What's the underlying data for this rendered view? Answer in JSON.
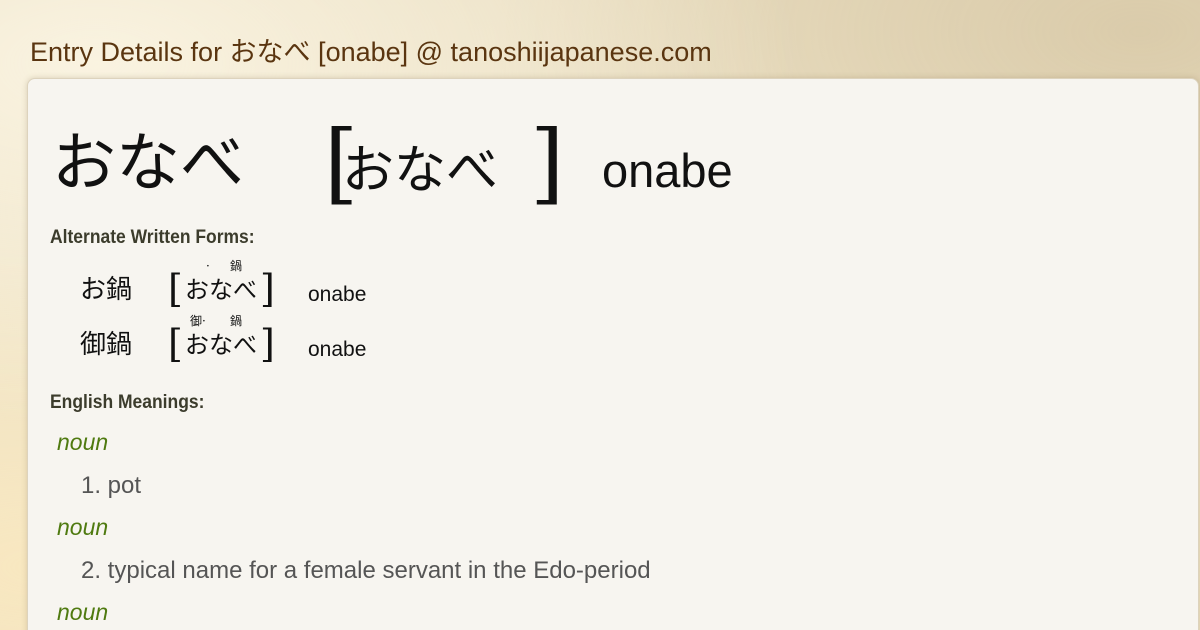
{
  "page_title": "Entry Details for おなべ [onabe] @ tanoshiijapanese.com",
  "entry": {
    "headword": "おなべ",
    "bracket_open": "[",
    "reading": "おなべ",
    "bracket_close": "]",
    "romaji": "onabe"
  },
  "alternate_forms": {
    "label": "Alternate Written Forms:",
    "items": [
      {
        "kanji": "お鍋",
        "bracket_open": "[",
        "reading": "おなべ",
        "bracket_close": "]",
        "furigana": [
          "·",
          "鍋"
        ],
        "romaji": "onabe"
      },
      {
        "kanji": "御鍋",
        "bracket_open": "[",
        "reading": "おなべ",
        "bracket_close": "]",
        "furigana": [
          "御·",
          "鍋"
        ],
        "romaji": "onabe"
      }
    ]
  },
  "meanings": {
    "label": "English Meanings:",
    "items": [
      {
        "pos": "noun",
        "text": "1. pot"
      },
      {
        "pos": "noun",
        "text": "2. typical name for a female servant in the Edo-period"
      },
      {
        "pos": "noun",
        "text": ""
      }
    ]
  },
  "colors": {
    "title": "#5a3510",
    "part_of_speech": "#4f7a10",
    "meaning_text": "#555555",
    "panel_background": "#f7f5f0"
  }
}
